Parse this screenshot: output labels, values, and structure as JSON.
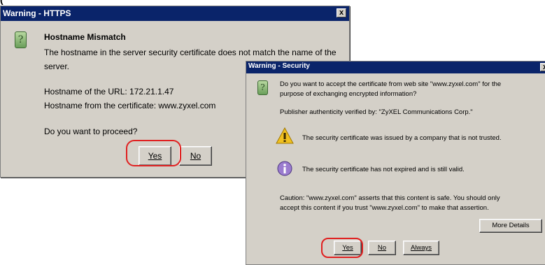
{
  "window_caption": "(",
  "https_dialog": {
    "title": "Warning - HTTPS",
    "close_label": "x",
    "heading": "Hostname Mismatch",
    "message_line1": "The hostname in the server security certificate does not match the name of the",
    "message_line2": "server.",
    "url_hostname": "Hostname of the URL: 172.21.1.47",
    "cert_hostname": "Hostname from the certificate: www.zyxel.com",
    "question": "Do you want to proceed?",
    "yes_label": "Yes",
    "no_label": "No",
    "icon": "question-icon"
  },
  "security_dialog": {
    "title": "Warning - Security",
    "close_label": "x",
    "accept_line1": "Do you want to accept the certificate from web site \"www.zyxel.com\" for the",
    "accept_line2": "purpose of exchanging encrypted information?",
    "publisher": "Publisher authenticity verified by: \"ZyXEL Communications Corp.\"",
    "untrusted": "The security certificate was issued by a company that is not trusted.",
    "valid": "The security certificate has not expired and is still valid.",
    "caution_line1": "Caution: \"www.zyxel.com\" asserts that this content is safe. You should only",
    "caution_line2": "accept this content if you trust \"www.zyxel.com\" to make that assertion.",
    "more_details_label": "More Details",
    "yes_label": "Yes",
    "no_label": "No",
    "always_label": "Always",
    "icons": [
      "question-icon",
      "warning-icon",
      "info-icon"
    ]
  },
  "colors": {
    "titlebar": "#0a246a",
    "dialog_bg": "#d4d0c8",
    "highlight": "#e02020"
  }
}
